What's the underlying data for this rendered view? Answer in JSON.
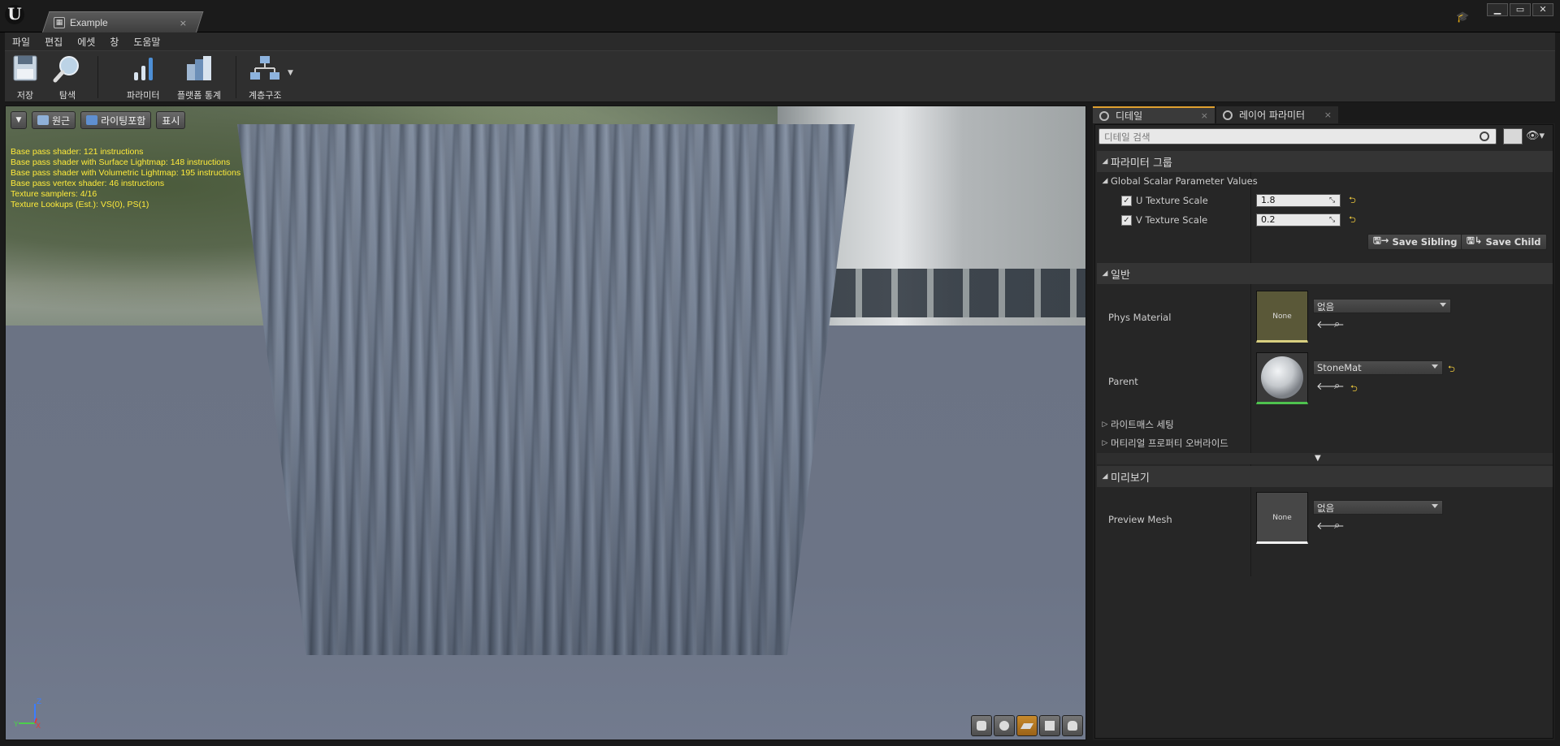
{
  "window": {
    "tab_title": "Example",
    "tab_close": "×",
    "min": "▁",
    "restore": "▭",
    "close": "✕",
    "logo": "U"
  },
  "menu": [
    "파일",
    "편집",
    "에셋",
    "창",
    "도움말"
  ],
  "toolbar": {
    "save": "저장",
    "browse": "탐색",
    "params": "파라미터",
    "platform_stats": "플랫폼 통계",
    "hierarchy": "계층구조"
  },
  "viewport": {
    "perspective_btn": "원근",
    "lit_btn": "라이팅포함",
    "show_btn": "표시",
    "stats": [
      "Base pass shader: 121 instructions",
      "Base pass shader with Surface Lightmap: 148 instructions",
      "Base pass shader with Volumetric Lightmap: 195 instructions",
      "Base pass vertex shader: 46 instructions",
      "Texture samplers: 4/16",
      "Texture Lookups (Est.): VS(0), PS(1)"
    ],
    "axis_z": "Z",
    "axis_y": "Y",
    "axis_x": "X"
  },
  "details": {
    "tab_details": "디테일",
    "tab_layer_params": "레이어 파라미터",
    "search_placeholder": "디테일 검색",
    "eye": "👁▾",
    "param_group": "파라미터 그룹",
    "global_scalar": "Global Scalar Parameter Values",
    "u_label": "U Texture Scale",
    "u_value": "1.8",
    "v_label": "V Texture Scale",
    "v_value": "0.2",
    "save_sibling": "Save Sibling",
    "save_child": "Save Child",
    "general": "일반",
    "phys_material_label": "Phys Material",
    "phys_material_thumb": "None",
    "phys_material_value": "없음",
    "parent_label": "Parent",
    "parent_value": "StoneMat",
    "lightmass": "라이트매스 세팅",
    "material_override": "머티리얼 프로퍼티 오버라이드",
    "preview": "미리보기",
    "preview_mesh_label": "Preview Mesh",
    "preview_mesh_thumb": "None",
    "preview_mesh_value": "없음"
  },
  "colors": {
    "accent": "#e0a030",
    "stats_text": "#ffeb3b",
    "reset": "#e6c23a"
  }
}
